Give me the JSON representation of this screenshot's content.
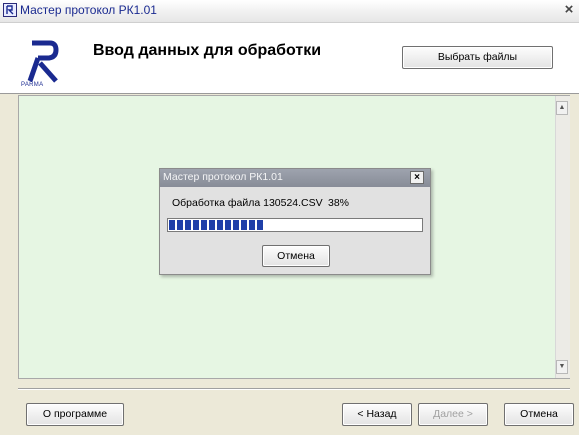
{
  "window": {
    "title": "Мастер протокол РК1.01",
    "close_glyph": "×"
  },
  "header": {
    "heading": "Ввод данных для обработки",
    "logo_text": "PARMA",
    "select_files_label": "Выбрать файлы"
  },
  "content": {
    "scroll_up_glyph": "▲",
    "scroll_down_glyph": "▼"
  },
  "progress_dialog": {
    "title": "Мастер протокол РК1.01",
    "close_glyph": "×",
    "status_text": "Обработка файла 130524.CSV",
    "percent_text": "38%",
    "progress_fraction": 0.38,
    "cancel_label": "Отмена"
  },
  "footer": {
    "about_label": "О программе",
    "back_label": "< Назад",
    "next_label": "Далее >",
    "cancel_label": "Отмена"
  },
  "colors": {
    "panel_bg": "#e6f6e3",
    "progress_block": "#1f3fa8",
    "title_text": "#1a2a90"
  },
  "icons": {
    "app": "parma-logo-icon",
    "close": "close-icon"
  }
}
